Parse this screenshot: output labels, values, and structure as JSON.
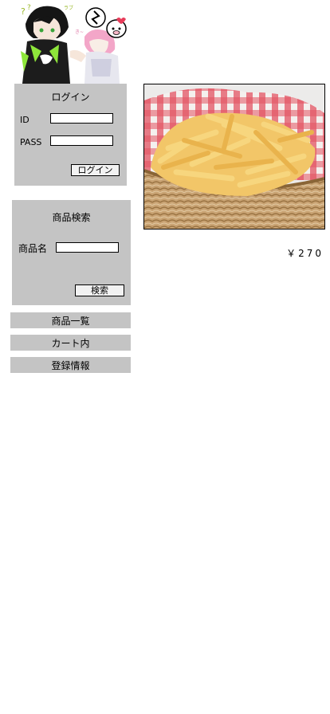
{
  "login": {
    "title": "ログイン",
    "id_label": "ID",
    "id_value": "",
    "pass_label": "PASS",
    "pass_value": "",
    "button_label": "ログイン"
  },
  "search": {
    "title": "商品検索",
    "name_label": "商品名",
    "name_value": "",
    "button_label": "検索"
  },
  "nav": {
    "products": "商品一覧",
    "cart": "カート内",
    "account": "登録情報"
  },
  "product": {
    "image_icon": "french-fries-photo",
    "price": "￥270"
  },
  "colors": {
    "panel": "#c4c4c4",
    "background": "#ffffff"
  }
}
